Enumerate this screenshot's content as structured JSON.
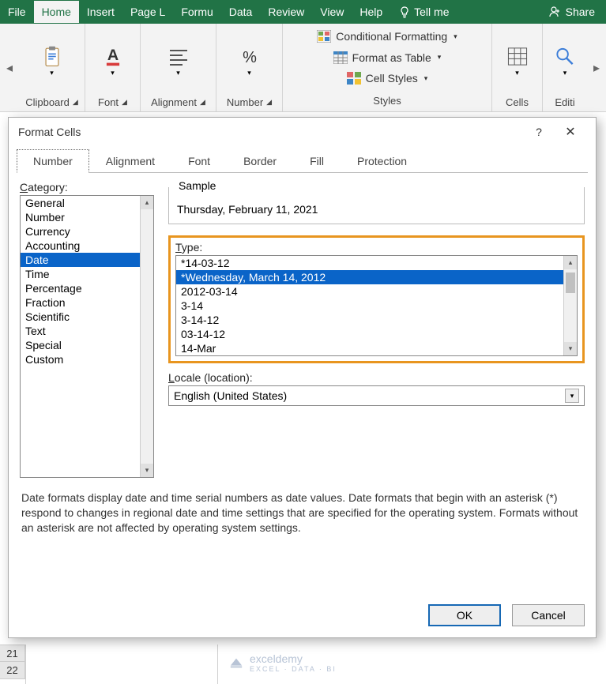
{
  "ribbon": {
    "tabs": [
      "File",
      "Home",
      "Insert",
      "Page L",
      "Formu",
      "Data",
      "Review",
      "View",
      "Help"
    ],
    "activeTab": "Home",
    "tellme": "Tell me",
    "share": "Share",
    "groups": {
      "clipboard": "Clipboard",
      "font": "Font",
      "alignment": "Alignment",
      "number": "Number",
      "cells": "Cells",
      "editing": "Editi"
    },
    "styles": {
      "conditional": "Conditional Formatting",
      "table": "Format as Table",
      "cellstyles": "Cell Styles",
      "label": "Styles"
    }
  },
  "dialog": {
    "title": "Format Cells",
    "tabs": [
      "Number",
      "Alignment",
      "Font",
      "Border",
      "Fill",
      "Protection"
    ],
    "activeTab": "Number",
    "category_label": "Category:",
    "categories": [
      "General",
      "Number",
      "Currency",
      "Accounting",
      "Date",
      "Time",
      "Percentage",
      "Fraction",
      "Scientific",
      "Text",
      "Special",
      "Custom"
    ],
    "selectedCategory": "Date",
    "sample_label": "Sample",
    "sample_value": "Thursday, February 11, 2021",
    "type_label": "Type:",
    "types": [
      "*14-03-12",
      "*Wednesday, March 14, 2012",
      "2012-03-14",
      "3-14",
      "3-14-12",
      "03-14-12",
      "14-Mar"
    ],
    "selectedType": "*Wednesday, March 14, 2012",
    "locale_label": "Locale (location):",
    "locale_value": "English (United States)",
    "description": "Date formats display date and time serial numbers as date values.  Date formats that begin with an asterisk (*) respond to changes in regional date and time settings that are specified for the operating system. Formats without an asterisk are not affected by operating system settings.",
    "ok": "OK",
    "cancel": "Cancel"
  },
  "sheet": {
    "row1": "21",
    "row2": "22"
  },
  "watermark": {
    "text": "exceldemy",
    "sub": "EXCEL · DATA · BI"
  }
}
